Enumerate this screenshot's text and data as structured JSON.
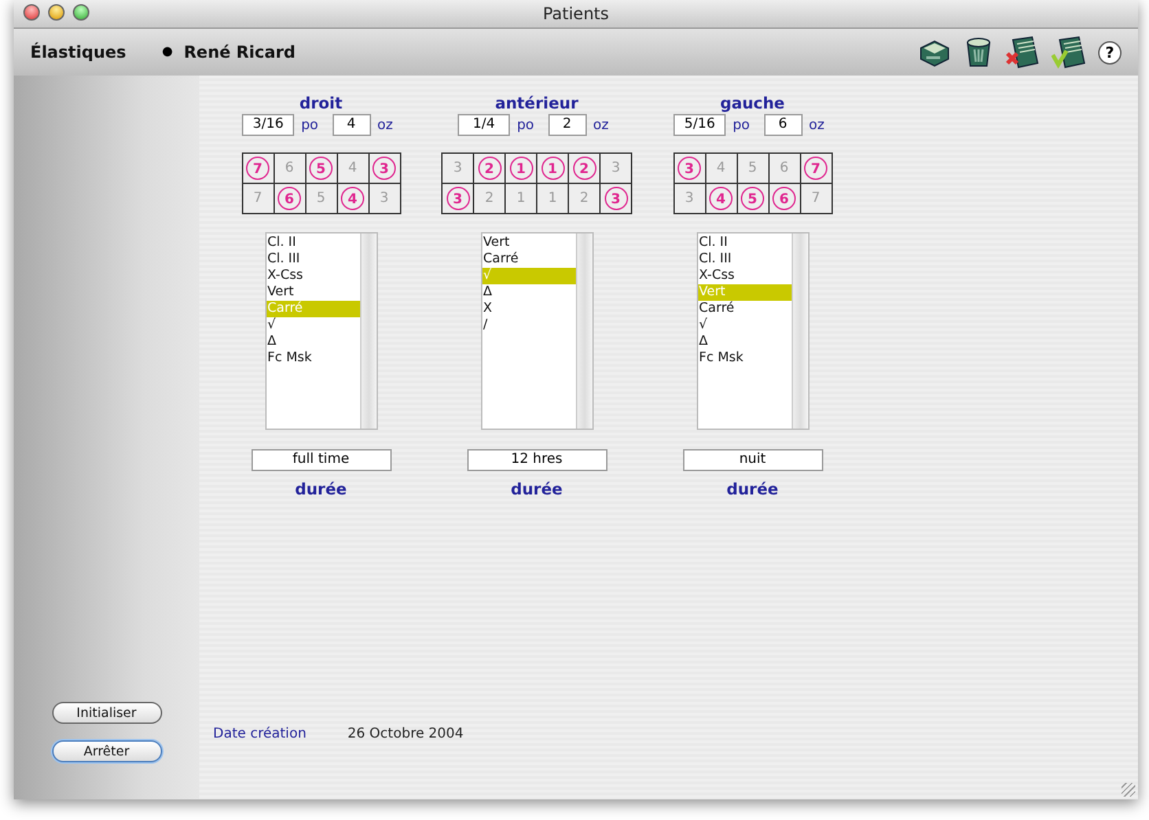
{
  "window": {
    "title": "Patients"
  },
  "header": {
    "section": "Élastiques",
    "bullet": "●",
    "patient": "René Ricard",
    "help": "?"
  },
  "columns": [
    {
      "title": "droit",
      "inches": "3/16",
      "inch_unit": "po",
      "ounces": "4",
      "ounce_unit": "oz",
      "teeth": [
        [
          {
            "label": "7",
            "circled": true
          },
          {
            "label": "6",
            "circled": false
          },
          {
            "label": "5",
            "circled": true
          },
          {
            "label": "4",
            "circled": false
          },
          {
            "label": "3",
            "circled": true
          }
        ],
        [
          {
            "label": "7",
            "circled": false
          },
          {
            "label": "6",
            "circled": true
          },
          {
            "label": "5",
            "circled": false
          },
          {
            "label": "4",
            "circled": true
          },
          {
            "label": "3",
            "circled": false
          }
        ]
      ],
      "options": [
        {
          "label": "Cl. II",
          "selected": false
        },
        {
          "label": "Cl. III",
          "selected": false
        },
        {
          "label": "X-Css",
          "selected": false
        },
        {
          "label": "Vert",
          "selected": false
        },
        {
          "label": "Carré",
          "selected": true
        },
        {
          "label": "√",
          "selected": false
        },
        {
          "label": "Δ",
          "selected": false
        },
        {
          "label": "Fc Msk",
          "selected": false
        }
      ],
      "duration": "full time",
      "duration_label": "durée"
    },
    {
      "title": "antérieur",
      "inches": "1/4",
      "inch_unit": "po",
      "ounces": "2",
      "ounce_unit": "oz",
      "teeth": [
        [
          {
            "label": "3",
            "circled": false
          },
          {
            "label": "2",
            "circled": true
          },
          {
            "label": "1",
            "circled": true
          },
          {
            "label": "1",
            "circled": true
          },
          {
            "label": "2",
            "circled": true
          },
          {
            "label": "3",
            "circled": false
          }
        ],
        [
          {
            "label": "3",
            "circled": true
          },
          {
            "label": "2",
            "circled": false
          },
          {
            "label": "1",
            "circled": false
          },
          {
            "label": "1",
            "circled": false
          },
          {
            "label": "2",
            "circled": false
          },
          {
            "label": "3",
            "circled": true
          }
        ]
      ],
      "options": [
        {
          "label": "Vert",
          "selected": false
        },
        {
          "label": "Carré",
          "selected": false
        },
        {
          "label": "√",
          "selected": true
        },
        {
          "label": "Δ",
          "selected": false
        },
        {
          "label": "X",
          "selected": false
        },
        {
          "label": "/",
          "selected": false
        }
      ],
      "duration": "12 hres",
      "duration_label": "durée"
    },
    {
      "title": "gauche",
      "inches": "5/16",
      "inch_unit": "po",
      "ounces": "6",
      "ounce_unit": "oz",
      "teeth": [
        [
          {
            "label": "3",
            "circled": true
          },
          {
            "label": "4",
            "circled": false
          },
          {
            "label": "5",
            "circled": false
          },
          {
            "label": "6",
            "circled": false
          },
          {
            "label": "7",
            "circled": true
          }
        ],
        [
          {
            "label": "3",
            "circled": false
          },
          {
            "label": "4",
            "circled": true
          },
          {
            "label": "5",
            "circled": true
          },
          {
            "label": "6",
            "circled": true
          },
          {
            "label": "7",
            "circled": false
          }
        ]
      ],
      "options": [
        {
          "label": "Cl. II",
          "selected": false
        },
        {
          "label": "Cl. III",
          "selected": false
        },
        {
          "label": "X-Css",
          "selected": false
        },
        {
          "label": "Vert",
          "selected": true
        },
        {
          "label": "Carré",
          "selected": false
        },
        {
          "label": "√",
          "selected": false
        },
        {
          "label": "Δ",
          "selected": false
        },
        {
          "label": "Fc Msk",
          "selected": false
        }
      ],
      "duration": "nuit",
      "duration_label": "durée"
    }
  ],
  "buttons": [
    "Initialiser",
    "Arrêter"
  ],
  "date": {
    "label": "Date création",
    "value": "26 Octobre 2004"
  }
}
